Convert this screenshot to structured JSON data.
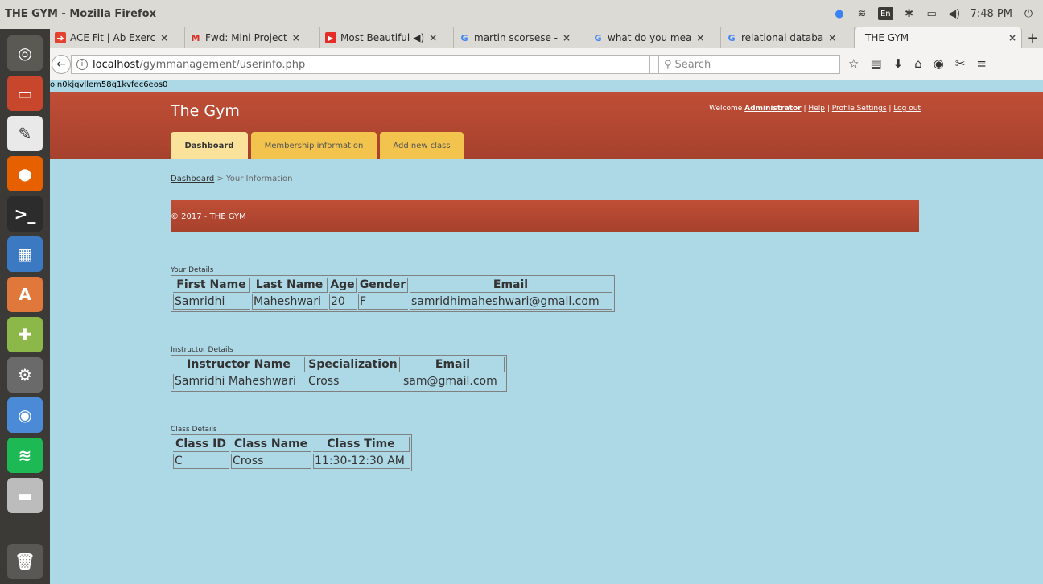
{
  "window": {
    "title": "THE GYM - Mozilla Firefox"
  },
  "tray": {
    "lang": "En",
    "clock": "7:48 PM"
  },
  "tabs": [
    {
      "label": "ACE Fit | Ab Exerc",
      "icon": "ace-fit-icon",
      "color": "#e4412f",
      "glyph": "➜"
    },
    {
      "label": "Fwd: Mini Project",
      "icon": "gmail-icon",
      "color": "#ffffff",
      "glyph": "M"
    },
    {
      "label": "Most Beautiful",
      "icon": "youtube-icon",
      "color": "#e52d27",
      "glyph": "▶"
    },
    {
      "label": "martin scorsese -",
      "icon": "google-icon",
      "color": "#ffffff",
      "glyph": "G"
    },
    {
      "label": "what do you mea",
      "icon": "google-icon",
      "color": "#ffffff",
      "glyph": "G"
    },
    {
      "label": "relational databa",
      "icon": "google-icon",
      "color": "#ffffff",
      "glyph": "G"
    },
    {
      "label": "THE GYM",
      "icon": "",
      "color": "",
      "glyph": ""
    }
  ],
  "url": {
    "host": "localhost",
    "path": "/gymmanagement/userinfo.php"
  },
  "search": {
    "placeholder": "Search"
  },
  "page": {
    "session_id": "ojn0kjqvllem58q1kvfec6eos0",
    "site_title": "The Gym",
    "welcome": "Welcome",
    "user": "Administrator",
    "links": {
      "help": "Help",
      "profile": "Profile Settings",
      "logout": "Log out",
      "sep": "|"
    },
    "nav": [
      "Dashboard",
      "Membership information",
      "Add new class"
    ],
    "breadcrumb": {
      "link": "Dashboard",
      "rest": " > Your Information"
    },
    "footer": "© 2017 - THE GYM"
  },
  "your_details": {
    "label": "Your Details",
    "headers": [
      "First Name",
      "Last Name",
      "Age",
      "Gender",
      "Email"
    ],
    "row": [
      "Samridhi",
      "Maheshwari",
      "20",
      "F",
      "samridhimaheshwari@gmail.com"
    ]
  },
  "instructor_details": {
    "label": "Instructor Details",
    "headers": [
      "Instructor Name",
      "Specialization",
      "Email"
    ],
    "row": [
      "Samridhi Maheshwari",
      "Cross",
      "sam@gmail.com"
    ]
  },
  "class_details": {
    "label": "Class Details",
    "headers": [
      "Class ID",
      "Class Name",
      "Class Time"
    ],
    "row": [
      "C",
      "Cross",
      "11:30-12:30 AM"
    ]
  },
  "colors": {
    "header": "#b44832",
    "page_bg": "#add8e6",
    "nav_tab": "#f2c34d",
    "nav_tab_active": "#fbe29a"
  }
}
